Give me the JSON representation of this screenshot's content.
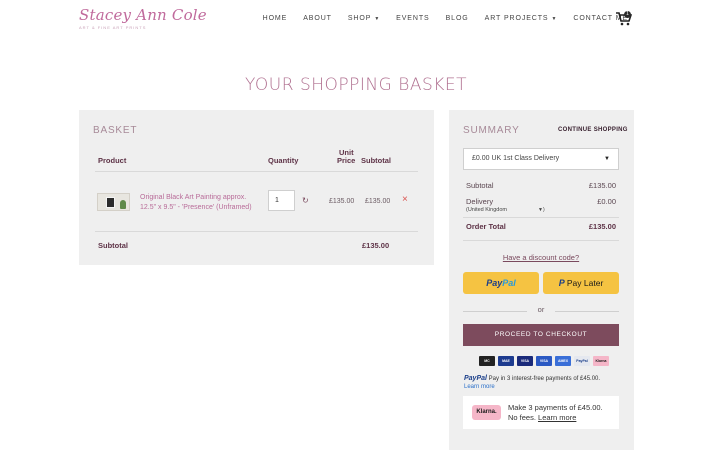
{
  "header": {
    "logo_script": "Stacey Ann Cole",
    "logo_tag": "ART & FINE ART PRINTS",
    "nav": [
      {
        "label": "HOME",
        "caret": ""
      },
      {
        "label": "ABOUT",
        "caret": ""
      },
      {
        "label": "SHOP",
        "caret": "▼"
      },
      {
        "label": "EVENTS",
        "caret": ""
      },
      {
        "label": "BLOG",
        "caret": ""
      },
      {
        "label": "ART PROJECTS",
        "caret": "▼"
      },
      {
        "label": "CONTACT ME",
        "caret": ""
      }
    ],
    "cart_count": "1"
  },
  "page_title": "YOUR SHOPPING BASKET",
  "basket": {
    "title": "BASKET",
    "headers": {
      "product": "Product",
      "quantity": "Quantity",
      "unit_price_1": "Unit",
      "unit_price_2": "Price",
      "subtotal": "Subtotal"
    },
    "item": {
      "name": "Original Black Art Painting approx. 12.5\" x 9.5\" - 'Presence' (Unframed)",
      "quantity": "1",
      "unit_price": "£135.00",
      "subtotal": "£135.00",
      "remove": "×"
    },
    "subtotal_label": "Subtotal",
    "subtotal_value": "£135.00"
  },
  "summary": {
    "title": "SUMMARY",
    "continue_link": "CONTINUE SHOPPING",
    "delivery_option": "£0.00 UK 1st Class Delivery",
    "subtotal_label": "Subtotal",
    "subtotal_value": "£135.00",
    "delivery_label": "Delivery",
    "delivery_value": "£0.00",
    "country": "(United Kingdom",
    "country_close": ")",
    "total_label": "Order Total",
    "total_value": "£135.00",
    "discount_link": "Have a discount code?",
    "paypal_a": "Pay",
    "paypal_b": "Pal",
    "paylater_icon": "P",
    "paylater": "Pay Later",
    "or": "or",
    "checkout": "PROCEED TO CHECKOUT",
    "cards": [
      {
        "name": "mastercard",
        "label": "MC",
        "color": "#222222"
      },
      {
        "name": "maestro",
        "label": "MAE",
        "color": "#1d3b8f"
      },
      {
        "name": "visa",
        "label": "VISA",
        "color": "#1a2a7a"
      },
      {
        "name": "visa-electron",
        "label": "VISA",
        "color": "#2b59c3"
      },
      {
        "name": "amex",
        "label": "AMEX",
        "color": "#3a6fd8"
      },
      {
        "name": "paypal",
        "label": "PayPal",
        "color": "#e5e8ef"
      },
      {
        "name": "klarna",
        "label": "Klarna",
        "color": "#f5b6c8"
      }
    ],
    "paypal_msg_logo": "PayPal",
    "paypal_msg": "Pay in 3 interest-free payments of £45.00.",
    "paypal_learn": "Learn more",
    "klarna_logo": "Klarna.",
    "klarna_text": "Make 3 payments of £45.00. No fees.",
    "klarna_learn": "Learn more"
  }
}
